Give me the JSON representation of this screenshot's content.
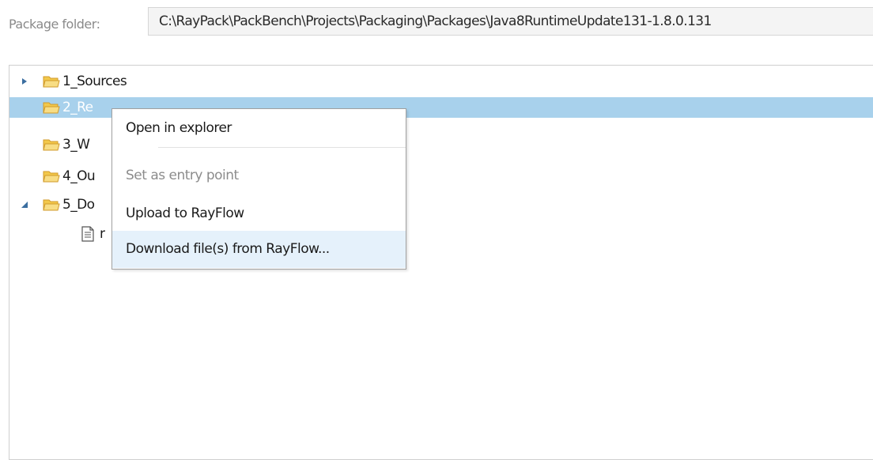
{
  "package": {
    "label": "Package folder:",
    "path": "C:\\RayPack\\PackBench\\Projects\\Packaging\\Packages\\Java8RuntimeUpdate131-1.8.0.131"
  },
  "tree": {
    "items": [
      {
        "label": "1_Sources",
        "expander": "collapsed"
      },
      {
        "label": "2_Re",
        "expander": "none",
        "selected": true
      },
      {
        "label": "3_W",
        "expander": "none"
      },
      {
        "label": "4_Ou",
        "expander": "none"
      },
      {
        "label": "5_Do",
        "expander": "expanded"
      },
      {
        "label": "r",
        "type": "file"
      }
    ]
  },
  "context_menu": {
    "items": [
      {
        "label": "Open in explorer",
        "enabled": true
      },
      {
        "label": "Set as entry point",
        "enabled": false
      },
      {
        "label": "Upload to RayFlow",
        "enabled": true
      },
      {
        "label": "Download file(s) from RayFlow...",
        "enabled": true,
        "hovered": true
      }
    ]
  },
  "colors": {
    "selection": "#a8d1ec",
    "menu_hover": "#e5f1fb",
    "folder_fill": "#f6d775",
    "folder_stroke": "#d19a2a"
  }
}
